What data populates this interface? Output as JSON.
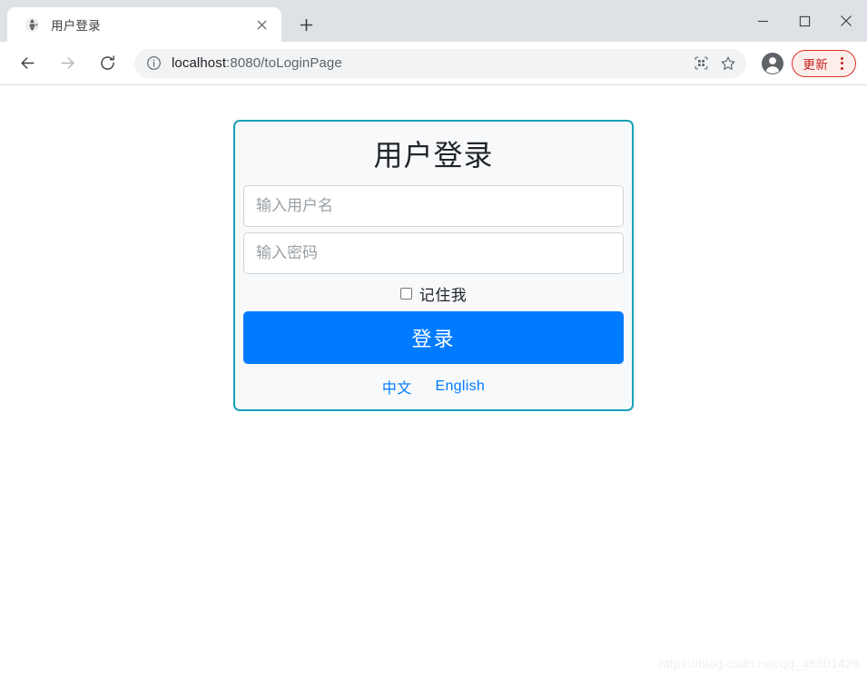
{
  "window": {
    "controls": {
      "minimize_label": "minimize",
      "maximize_label": "maximize",
      "close_label": "close"
    }
  },
  "tabs": [
    {
      "title": "用户登录",
      "favicon": "globe-icon",
      "close_label": "×",
      "active": true
    }
  ],
  "new_tab_label": "+",
  "toolbar": {
    "back_label": "back",
    "forward_label": "forward",
    "reload_label": "reload",
    "security_icon": "info-circle-icon",
    "url_host": "localhost",
    "url_path": ":8080/toLoginPage",
    "url_full": "localhost:8080/toLoginPage",
    "qr_icon": "qr-code-icon",
    "bookmark_icon": "star-icon",
    "profile_icon": "account-avatar-icon",
    "update_label": "更新",
    "menu_icon": "kebab-menu-icon"
  },
  "page": {
    "card": {
      "title": "用户登录",
      "username": {
        "value": "",
        "placeholder": "输入用户名"
      },
      "password": {
        "value": "",
        "placeholder": "输入密码"
      },
      "remember": {
        "label": "记住我",
        "checked": false
      },
      "submit_label": "登录",
      "languages": [
        {
          "label": "中文"
        },
        {
          "label": "English"
        }
      ]
    },
    "watermark": "https://blog.csdn.net/qq_46301426"
  },
  "colors": {
    "card_border": "#17a2b8",
    "card_bg": "#f8f9fa",
    "primary": "#007bff",
    "update_red": "#d93025",
    "chrome_titlebar": "#dee1e6"
  }
}
